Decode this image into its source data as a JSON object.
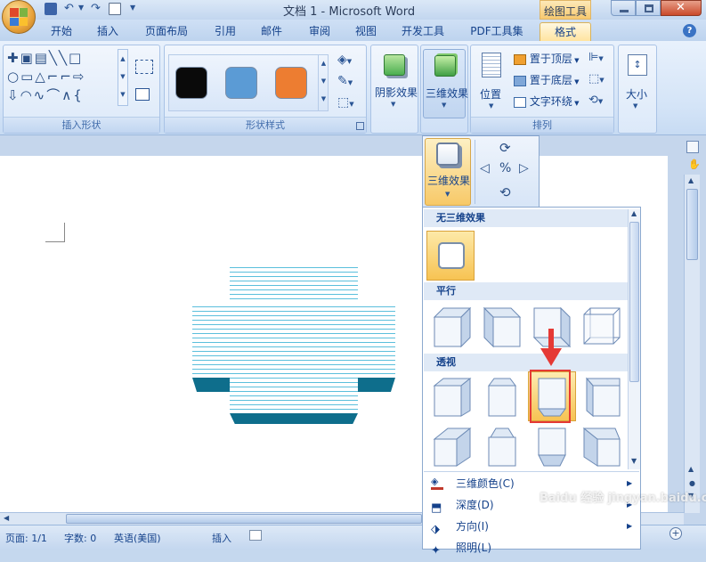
{
  "window": {
    "title": "文档 1 - Microsoft Word",
    "contextual_tab": "绘图工具"
  },
  "tabs": [
    "开始",
    "插入",
    "页面布局",
    "引用",
    "邮件",
    "审阅",
    "视图",
    "开发工具",
    "PDF工具集",
    "格式"
  ],
  "ribbon": {
    "insert_shapes": {
      "label": "插入形状"
    },
    "shape_styles": {
      "label": "形状样式",
      "swatch_colors": [
        "#0a0a0a",
        "#5b9bd5",
        "#ed7d31"
      ]
    },
    "shadow": {
      "label": "阴影效果"
    },
    "threed": {
      "label": "三维效果"
    },
    "arrange": {
      "label": "排列",
      "position": "位置",
      "bring_front": "置于顶层",
      "send_back": "置于底层",
      "text_wrap": "文字环绕"
    },
    "size": {
      "label": "大小"
    }
  },
  "popup": {
    "threed_label": "三维效果"
  },
  "gallery": {
    "none_section": "无三维效果",
    "parallel_section": "平行",
    "perspective_section": "透视"
  },
  "menu": {
    "color": "三维颜色(C)",
    "depth": "深度(D)",
    "direction": "方向(I)",
    "lighting": "照明(L)"
  },
  "status": {
    "page": "页面: 1/1",
    "words": "字数: 0",
    "language": "英语(美国)",
    "mode": "插入"
  },
  "colors": {
    "shape_fill": "#5bbfdc",
    "shape_dark": "#0e6e8c",
    "highlight": "#ffe39a",
    "arrow": "#e53935"
  },
  "watermark": "Baidu 经验 jingyan.baidu.com"
}
